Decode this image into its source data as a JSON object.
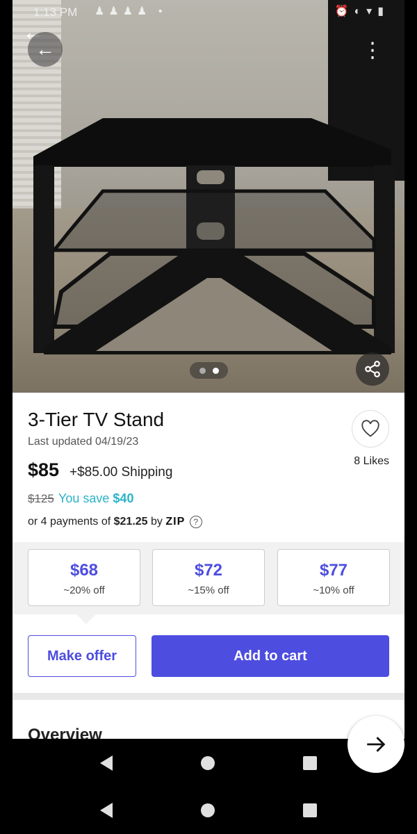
{
  "status": {
    "time": "1:13 PM"
  },
  "product": {
    "title": "3-Tier TV Stand",
    "updated": "Last updated 04/19/23",
    "likes": "8 Likes",
    "price": "$85",
    "shipping": "+$85.00 Shipping",
    "original_price": "$125",
    "save_prefix": "You save",
    "save_amount": "$40",
    "zip_prefix": "or 4 payments of",
    "zip_amount": "$21.25",
    "zip_by": "by",
    "zip_logo": "ZIP"
  },
  "image_pager": {
    "count": 2,
    "active": 2
  },
  "offers": [
    {
      "amount": "$68",
      "discount": "~20% off"
    },
    {
      "amount": "$72",
      "discount": "~15% off"
    },
    {
      "amount": "$77",
      "discount": "~10% off"
    }
  ],
  "actions": {
    "make_offer": "Make offer",
    "add_to_cart": "Add to cart"
  },
  "section": {
    "overview": "Overview"
  },
  "colors": {
    "accent": "#4d4de0",
    "savings": "#2bb3c8"
  }
}
